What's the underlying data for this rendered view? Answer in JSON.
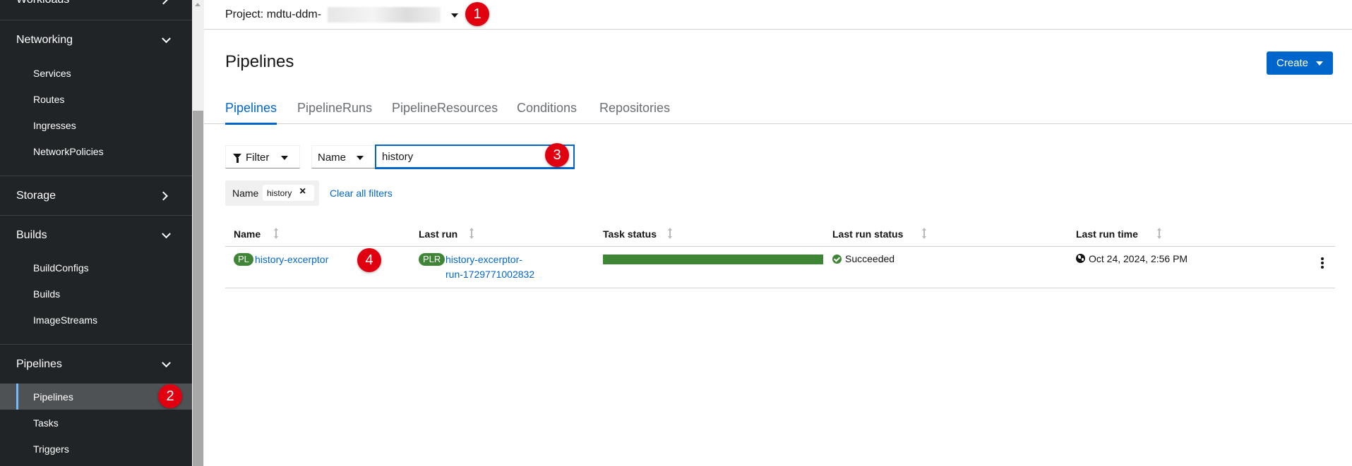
{
  "sidebar": {
    "workloads_label": "Workloads",
    "networking": {
      "label": "Networking",
      "items": [
        "Services",
        "Routes",
        "Ingresses",
        "NetworkPolicies"
      ]
    },
    "storage_label": "Storage",
    "builds": {
      "label": "Builds",
      "items": [
        "BuildConfigs",
        "Builds",
        "ImageStreams"
      ]
    },
    "pipelines": {
      "label": "Pipelines",
      "items": [
        "Pipelines",
        "Tasks",
        "Triggers"
      ],
      "active": "Pipelines"
    }
  },
  "project": {
    "label": "Project: mdtu-ddm-"
  },
  "page": {
    "title": "Pipelines",
    "create_label": "Create"
  },
  "tabs": [
    "Pipelines",
    "PipelineRuns",
    "PipelineResources",
    "Conditions",
    "Repositories"
  ],
  "filter": {
    "filter_label": "Filter",
    "attribute_label": "Name",
    "search_value": "history",
    "chip_category": "Name",
    "chip_value": "history",
    "clear_label": "Clear all filters"
  },
  "table": {
    "columns": [
      "Name",
      "Last run",
      "Task status",
      "Last run status",
      "Last run time"
    ],
    "rows": [
      {
        "name_badge": "PL",
        "name": "history-excerptor",
        "last_run_badge": "PLR",
        "last_run_line1": "history-excerptor-",
        "last_run_line2": "run-1729771002832",
        "task_status_fraction": 1.0,
        "last_run_status": "Succeeded",
        "last_run_time": "Oct 24, 2024, 2:56 PM"
      }
    ]
  },
  "annotations": [
    "1",
    "2",
    "3",
    "4"
  ],
  "colors": {
    "accent": "#0066cc",
    "success": "#3e8635",
    "badge_red": "#e1000f",
    "sidebar_bg": "#212427"
  }
}
